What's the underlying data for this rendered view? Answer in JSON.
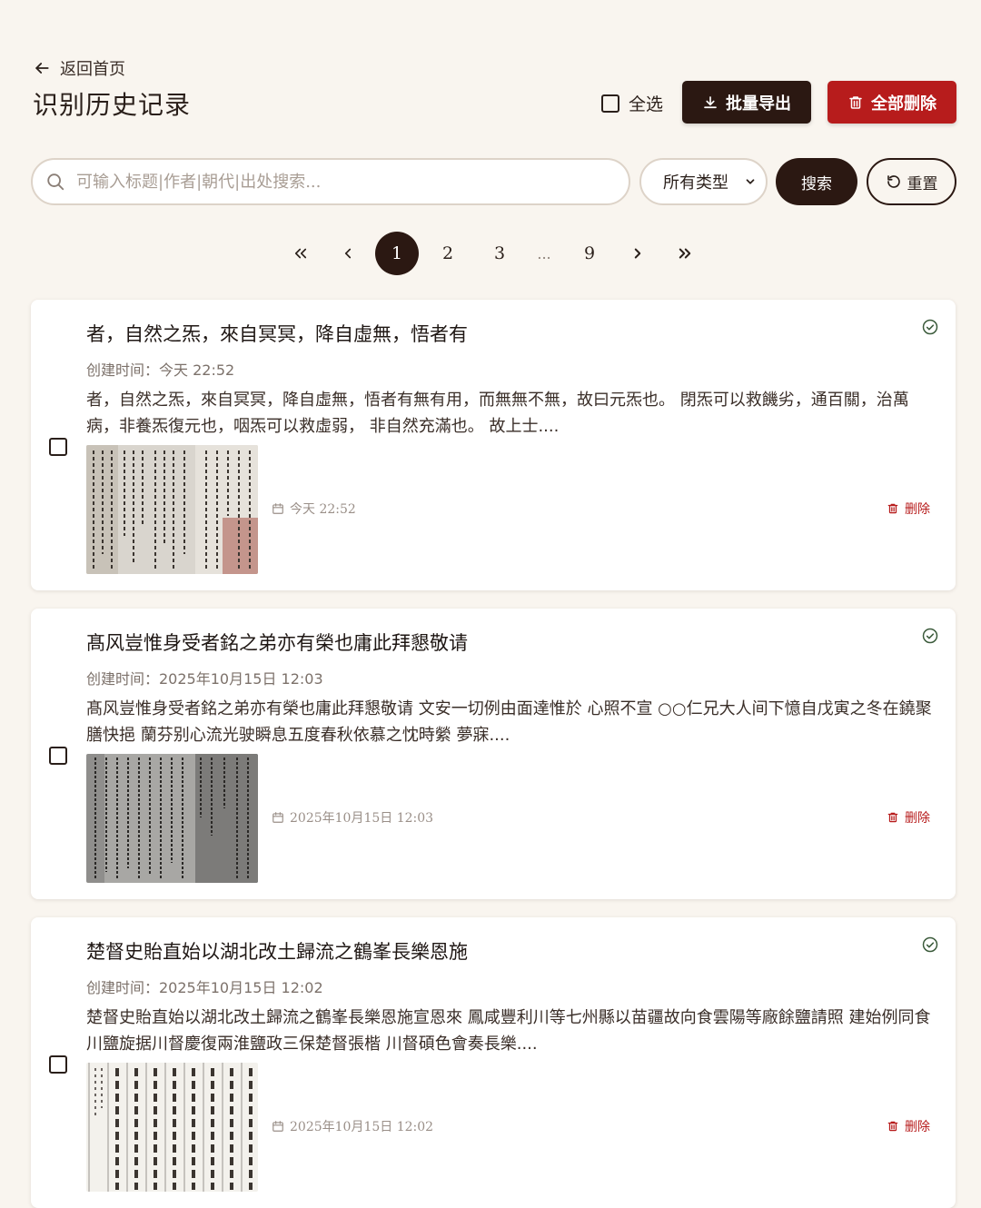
{
  "header": {
    "back_label": "返回首页",
    "title": "识别历史记录",
    "select_all_label": "全选",
    "export_label": "批量导出",
    "delete_all_label": "全部删除"
  },
  "search": {
    "placeholder": "可输入标题|作者|朝代|出处搜索...",
    "type_selected": "所有类型",
    "search_label": "搜索",
    "reset_label": "重置"
  },
  "pagination": {
    "pages": [
      "1",
      "2",
      "3",
      "...",
      "9"
    ],
    "current": "1"
  },
  "records": [
    {
      "title": "者，自然之炁，來自冥冥，降自虛無，悟者有",
      "created": "创建时间：今天 22:52",
      "excerpt": "者，自然之炁，來自冥冥，降自虛無，悟者有無有用，而無無不無，故曰元炁也。 閉炁可以救饑劣，通百關，治萬病，非養炁復元也，咽炁可以救虛弱， 非自然充滿也。 故上士....",
      "date": "今天 22:52",
      "delete_label": "删除"
    },
    {
      "title": "髙风豈惟身受者銘之弟亦有榮也庸此拜懇敬请",
      "created": "创建时间：2025年10月15日 12:03",
      "excerpt": "髙风豈惟身受者銘之弟亦有榮也庸此拜懇敬请 文安一切例由面達惟於 心照不宣 ○○仁兄大人间下憶自戊寅之冬在鐃聚膳快挹 蘭芬别心流光驶瞬息五度春秋依慕之忱時縈 夢寐....",
      "date": "2025年10月15日 12:03",
      "delete_label": "删除"
    },
    {
      "title": "楚督史貽直始以湖北改土歸流之鶴峯長樂恩施",
      "created": "创建时间：2025年10月15日 12:02",
      "excerpt": "楚督史貽直始以湖北改土歸流之鶴峯長樂恩施宣恩來 鳳咸豐利川等七州縣以苗疆故向食雲陽等廠餘鹽請照 建始例同食川鹽旋据川督慶復兩淮鹽政三保楚督張楷 川督碩色會奏長樂....",
      "date": "2025年10月15日 12:02",
      "delete_label": "删除"
    }
  ]
}
